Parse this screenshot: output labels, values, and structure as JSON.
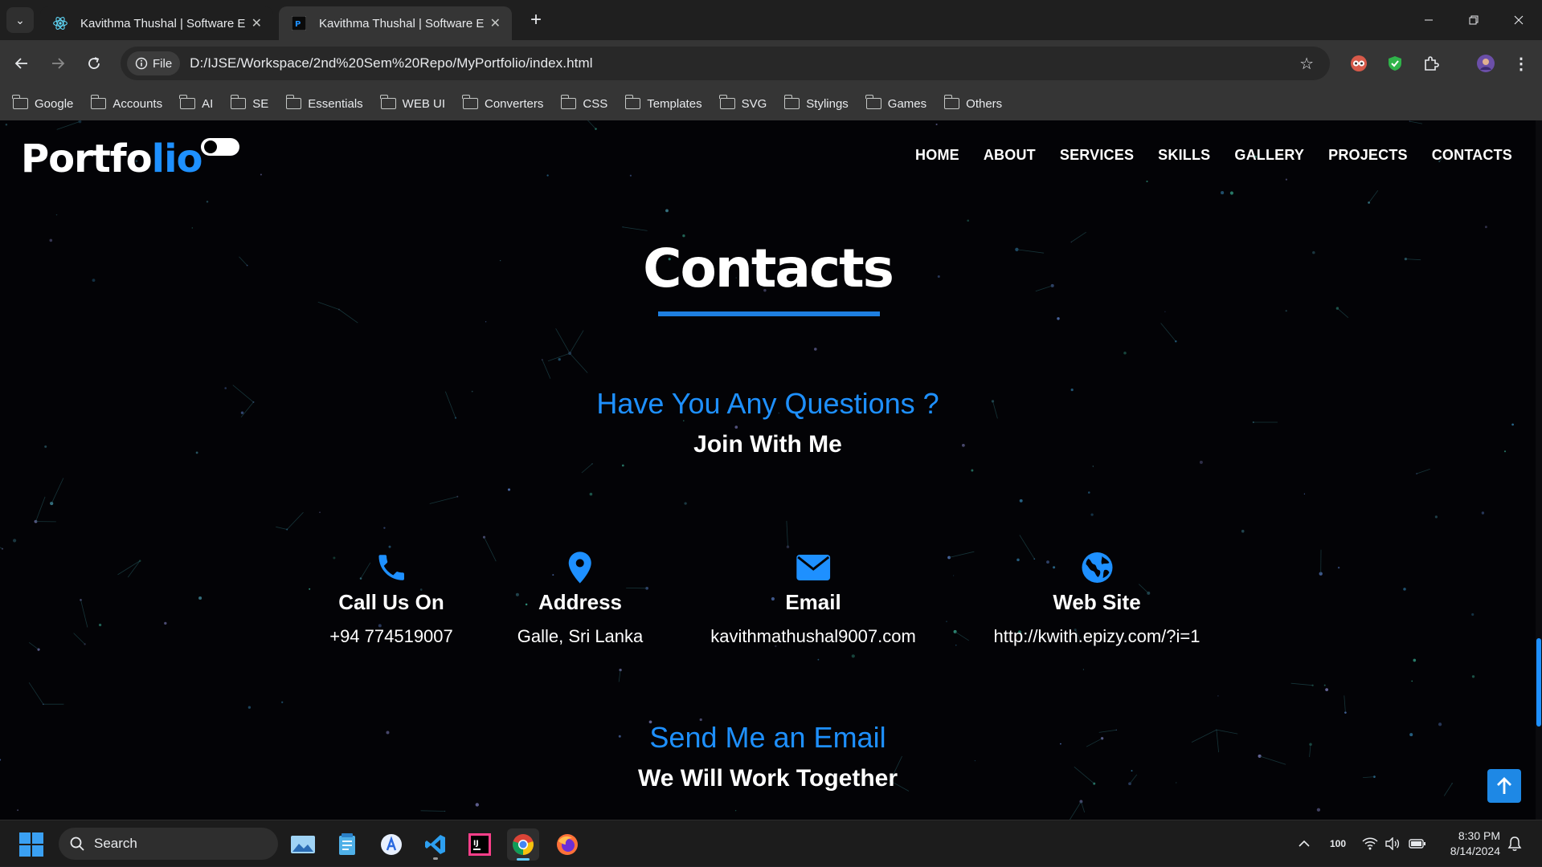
{
  "browser": {
    "tabs": [
      {
        "title": "Kavithma Thushal | Software Engineer",
        "active": false
      },
      {
        "title": "Kavithma Thushal | Software Engineer",
        "active": true
      }
    ],
    "new_tab_label": "+",
    "file_chip_label": "File",
    "url": "D:/IJSE/Workspace/2nd%20Sem%20Repo/MyPortfolio/index.html",
    "bookmarks": [
      "Google",
      "Accounts",
      "AI",
      "SE",
      "Essentials",
      "WEB UI",
      "Converters",
      "CSS",
      "Templates",
      "SVG",
      "Stylings",
      "Games",
      "Others"
    ]
  },
  "page": {
    "logo_main": "Portfo",
    "logo_accent": "lio",
    "nav": [
      "HOME",
      "ABOUT",
      "SERVICES",
      "SKILLS",
      "GALLERY",
      "PROJECTS",
      "CONTACTS"
    ],
    "section_title": "Contacts",
    "questions_heading": "Have You Any Questions ?",
    "questions_sub": "Join With Me",
    "contact_items": [
      {
        "icon": "phone-icon",
        "label": "Call Us On",
        "value": "+94 774519007"
      },
      {
        "icon": "location-pin-icon",
        "label": "Address",
        "value": "Galle, Sri Lanka"
      },
      {
        "icon": "envelope-icon",
        "label": "Email",
        "value": "kavithmathushal9007.com"
      },
      {
        "icon": "globe-icon",
        "label": "Web Site",
        "value": "http://kwith.epizy.com/?i=1"
      }
    ],
    "email_heading": "Send Me an Email",
    "email_sub": "We Will Work Together",
    "accent_color": "#1e90ff"
  },
  "taskbar": {
    "search_placeholder": "Search",
    "tray_battery_text": "100",
    "time": "8:30 PM",
    "date": "8/14/2024"
  }
}
